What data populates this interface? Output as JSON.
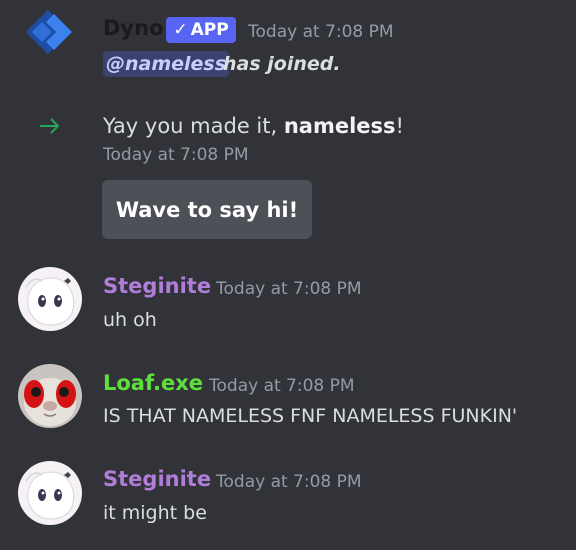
{
  "messages": {
    "dyno": {
      "username": "Dyno",
      "badge": "APP",
      "badge_check": "✓",
      "timestamp": "Today at 7:08 PM",
      "mention": "@nameless",
      "joined_text": "has joined.",
      "brand_color": "#2f6fd6"
    },
    "welcome": {
      "text_prefix": "Yay you made it, ",
      "name": "nameless",
      "text_suffix": "!",
      "timestamp": "Today at 7:08 PM",
      "button_label": "Wave to say hi!",
      "arrow_color": "#23a55a"
    },
    "steginite_1": {
      "username": "Steginite",
      "color": "#b07ed8",
      "timestamp": "Today at 7:08 PM",
      "text": "uh oh"
    },
    "loaf": {
      "username": "Loaf.exe",
      "color": "#5ee03c",
      "timestamp": "Today at 7:08 PM",
      "text": "IS THAT NAMELESS FNF NAMELESS FUNKIN'"
    },
    "steginite_2": {
      "username": "Steginite",
      "color": "#b07ed8",
      "timestamp": "Today at 7:08 PM",
      "text": "it might be"
    }
  }
}
